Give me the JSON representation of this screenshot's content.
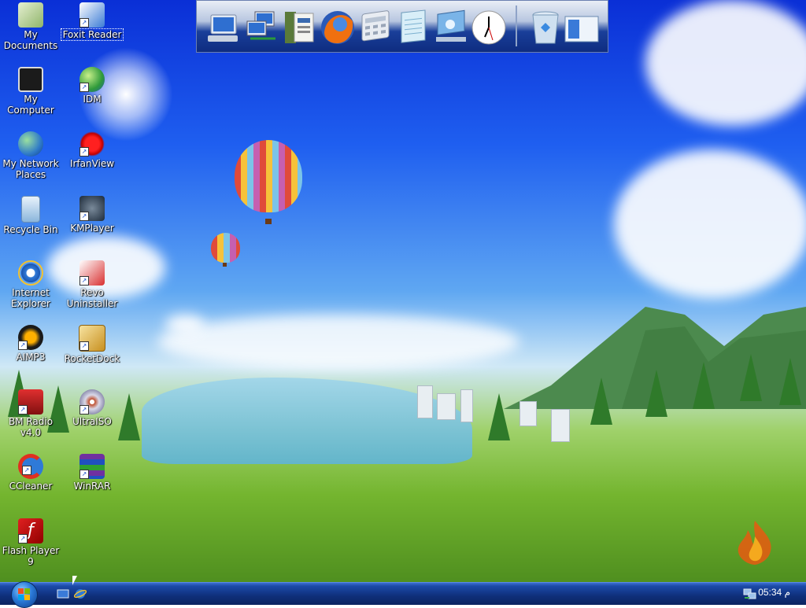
{
  "desktop": {
    "icons": [
      {
        "label": "My\nDocuments",
        "icon": "folder-documents-icon"
      },
      {
        "label": "Foxit Reader",
        "icon": "pdf-reader-icon",
        "shortcut": true
      },
      {
        "label": "My Computer",
        "icon": "monitor-icon"
      },
      {
        "label": "IDM",
        "icon": "globe-arrow-icon",
        "shortcut": true
      },
      {
        "label": "My Network\nPlaces",
        "icon": "network-globe-icon"
      },
      {
        "label": "IrfanView",
        "icon": "red-splat-icon",
        "shortcut": true
      },
      {
        "label": "Recycle Bin",
        "icon": "trash-icon"
      },
      {
        "label": "KMPlayer",
        "icon": "kmp-icon",
        "shortcut": true
      },
      {
        "label": "Internet\nExplorer",
        "icon": "ie-icon"
      },
      {
        "label": "Revo\nUninstaller",
        "icon": "uninstaller-icon",
        "shortcut": true
      },
      {
        "label": "AIMP3",
        "icon": "triangle-player-icon",
        "shortcut": true
      },
      {
        "label": "RocketDock",
        "icon": "rocket-r-icon",
        "shortcut": true
      },
      {
        "label": "BM Radio\nv4.0",
        "icon": "radio-icon",
        "shortcut": true
      },
      {
        "label": "UltraISO",
        "icon": "disc-icon",
        "shortcut": true
      },
      {
        "label": "CCleaner",
        "icon": "ccleaner-icon",
        "shortcut": true
      },
      {
        "label": "WinRAR",
        "icon": "archive-books-icon",
        "shortcut": true
      },
      {
        "label": "Flash Player\n9",
        "icon": "flash-icon",
        "shortcut": true
      }
    ]
  },
  "dock": {
    "items": [
      {
        "icon": "my-computer-icon"
      },
      {
        "icon": "network-icon"
      },
      {
        "icon": "documents-icon"
      },
      {
        "icon": "firefox-icon"
      },
      {
        "icon": "calculator-icon"
      },
      {
        "icon": "notepad-icon"
      },
      {
        "icon": "control-panel-icon"
      },
      {
        "icon": "clock-icon"
      },
      {
        "icon": "recycle-bin-icon"
      },
      {
        "icon": "show-desktop-icon"
      }
    ]
  },
  "taskbar": {
    "start_icon": "windows-orb-icon",
    "quick_launch": [
      {
        "icon": "show-desktop-icon"
      },
      {
        "icon": "ie-icon"
      }
    ],
    "tray": {
      "network_icon": "network-tray-icon",
      "clock": "05:34 م"
    }
  },
  "colors": {
    "taskbar": "#0f2f7a",
    "sky_top": "#0a2fd6",
    "grass": "#74b52f"
  }
}
